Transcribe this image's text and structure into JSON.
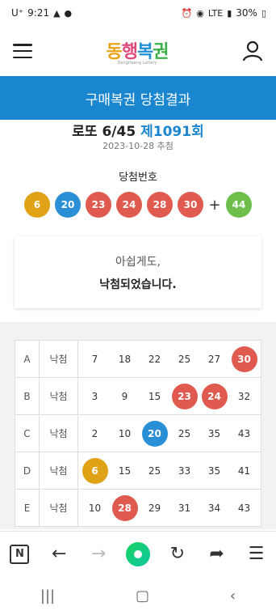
{
  "status": {
    "carrier": "U⁺",
    "time": "9:21",
    "battery": "30%",
    "network": "LTE"
  },
  "header": {
    "logo_text_1": "동",
    "logo_text_2": "행",
    "logo_text_3": "복",
    "logo_text_4": "권",
    "logo_sub": "DongHaeng Lottery"
  },
  "banner": {
    "title": "구매복권 당첨결과"
  },
  "draw": {
    "game": "로또 6/45",
    "round": "제1091회",
    "date": "2023-10-28 추첨"
  },
  "winning": {
    "label": "당첨번호",
    "numbers": [
      {
        "value": "6",
        "color": "#e0a217"
      },
      {
        "value": "20",
        "color": "#2b8fd6"
      },
      {
        "value": "23",
        "color": "#e15a4f"
      },
      {
        "value": "24",
        "color": "#e15a4f"
      },
      {
        "value": "28",
        "color": "#e15a4f"
      },
      {
        "value": "30",
        "color": "#e15a4f"
      }
    ],
    "plus": "+",
    "bonus": {
      "value": "44",
      "color": "#6dbf4a"
    }
  },
  "result": {
    "line1": "아쉽게도,",
    "line2": "낙첨되었습니다."
  },
  "games": [
    {
      "slot": "A",
      "status": "낙첨",
      "numbers": [
        "7",
        "18",
        "22",
        "25",
        "27",
        "30"
      ],
      "hits": [
        null,
        null,
        null,
        null,
        null,
        "#e15a4f"
      ]
    },
    {
      "slot": "B",
      "status": "낙첨",
      "numbers": [
        "3",
        "9",
        "15",
        "23",
        "24",
        "32"
      ],
      "hits": [
        null,
        null,
        null,
        "#e15a4f",
        "#e15a4f",
        null
      ]
    },
    {
      "slot": "C",
      "status": "낙첨",
      "numbers": [
        "2",
        "10",
        "20",
        "25",
        "35",
        "43"
      ],
      "hits": [
        null,
        null,
        "#2b8fd6",
        null,
        null,
        null
      ]
    },
    {
      "slot": "D",
      "status": "낙첨",
      "numbers": [
        "6",
        "15",
        "25",
        "33",
        "35",
        "41"
      ],
      "hits": [
        "#e0a217",
        null,
        null,
        null,
        null,
        null
      ]
    },
    {
      "slot": "E",
      "status": "낙첨",
      "numbers": [
        "10",
        "28",
        "29",
        "31",
        "34",
        "43"
      ],
      "hits": [
        null,
        "#e15a4f",
        null,
        null,
        null,
        null
      ]
    }
  ],
  "browser": {
    "n_label": "N"
  }
}
